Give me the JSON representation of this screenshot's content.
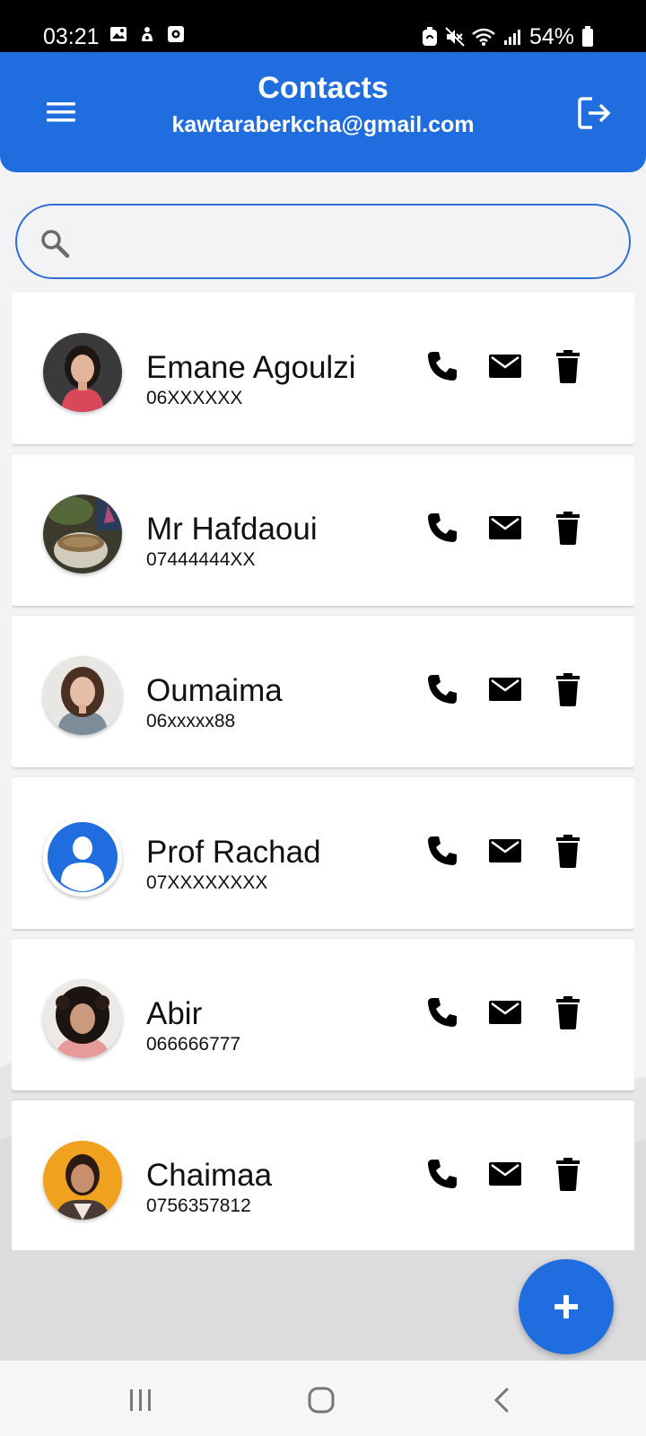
{
  "status_bar": {
    "time": "03:21",
    "battery": "54%",
    "icons": [
      "gallery-icon",
      "notification-icon",
      "screen-record-icon",
      "battery-saver-icon",
      "mute-icon",
      "wifi-icon",
      "signal-icon",
      "battery-icon"
    ]
  },
  "header": {
    "title": "Contacts",
    "subtitle": "kawtaraberkcha@gmail.com",
    "menu_icon": "menu-icon",
    "logout_icon": "logout-icon",
    "color": "#1f6ddf"
  },
  "search": {
    "placeholder": "",
    "value": "",
    "icon": "search-icon"
  },
  "contacts": [
    {
      "name": "Emane Agoulzi",
      "phone": "06XXXXXX"
    },
    {
      "name": "Mr Hafdaoui",
      "phone": "07444444XX"
    },
    {
      "name": "Oumaima",
      "phone": "06xxxxx88"
    },
    {
      "name": "Prof Rachad",
      "phone": "07XXXXXXXX"
    },
    {
      "name": "Abir",
      "phone": "066666777"
    },
    {
      "name": "Chaimaa",
      "phone": "0756357812"
    }
  ],
  "actions": [
    "phone-icon",
    "mail-icon",
    "delete-icon"
  ],
  "fab": {
    "icon": "plus-icon"
  },
  "nav": [
    "recent-apps-icon",
    "home-icon",
    "back-icon"
  ]
}
